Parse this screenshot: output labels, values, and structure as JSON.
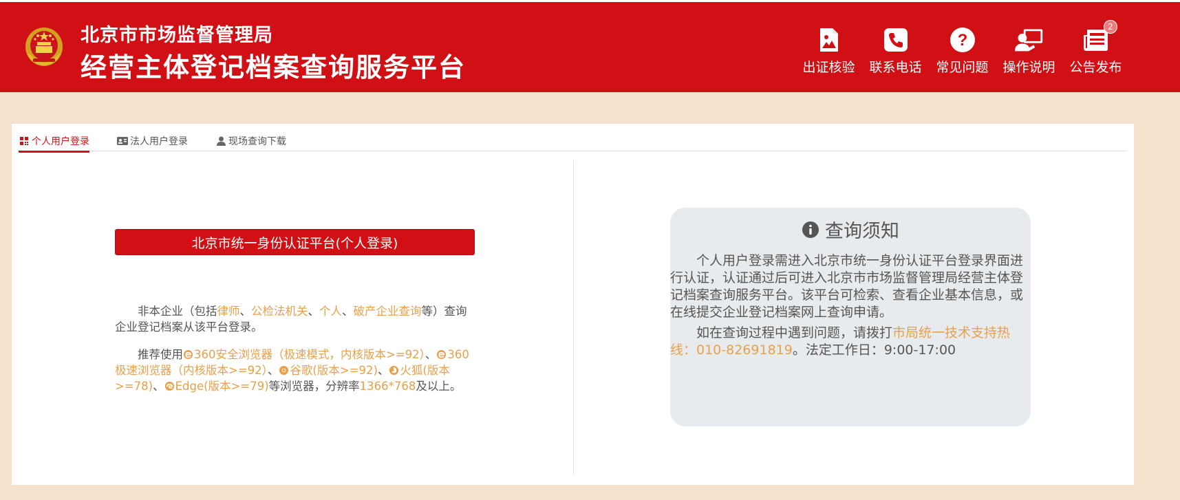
{
  "header": {
    "title_line1": "北京市市场监督管理局",
    "title_line2": "经营主体登记档案查询服务平台",
    "brand_color": "#d01015",
    "nav": [
      {
        "label": "出证核验",
        "icon": "image-file-icon"
      },
      {
        "label": "联系电话",
        "icon": "phone-icon"
      },
      {
        "label": "常见问题",
        "icon": "question-icon"
      },
      {
        "label": "操作说明",
        "icon": "user-screen-icon"
      },
      {
        "label": "公告发布",
        "icon": "newspaper-icon",
        "badge": "2"
      }
    ]
  },
  "tabs": [
    {
      "label": "个人用户登录",
      "icon": "grid-icon",
      "active": true
    },
    {
      "label": "法人用户登录",
      "icon": "id-card-icon",
      "active": false
    },
    {
      "label": "现场查询下载",
      "icon": "user-icon",
      "active": false
    }
  ],
  "login": {
    "button_label": "北京市统一身份认证平台(个人登录)",
    "p1": {
      "t1": "非本企业（包括",
      "h1": "律师",
      "t2": "、",
      "h2": "公检法机关",
      "t3": "、",
      "h3": "个人",
      "t4": "、",
      "h4": "破产企业查询",
      "t5": "等）查询企业登记档案从该平台登录。"
    },
    "p2": {
      "t1": "推荐使用",
      "b1": "360安全浏览器（极速模式，内核版本>=92）",
      "t2": "、",
      "b2": "360极速浏览器（内核版本>=92）",
      "t3": "、",
      "b3": "谷歌(版本>=92)",
      "t4": "、",
      "b4": "火狐(版本>=78)",
      "t5": "、",
      "b5": "Edge(版本>=79)",
      "t6": "等浏览器，分辨率",
      "res": "1366*768",
      "t7": "及以上。"
    }
  },
  "notice": {
    "title": "查询须知",
    "p1": "个人用户登录需进入北京市统一身份认证平台登录界面进行认证，认证通过后可进入北京市市场监督管理局经营主体登记档案查询服务平台。该平台可检索、查看企业基本信息，或在线提交企业登记档案网上查询申请。",
    "p2_pre": "如在查询过程中遇到问题，请拨打",
    "p2_hl": "市局统一技术支持热线：010-82691819",
    "p2_post": "。法定工作日：9:00-17:00"
  },
  "colors": {
    "accent_orange": "#e8a04a",
    "page_bg": "#f5e1cc",
    "notice_bg": "#e8ebee"
  }
}
